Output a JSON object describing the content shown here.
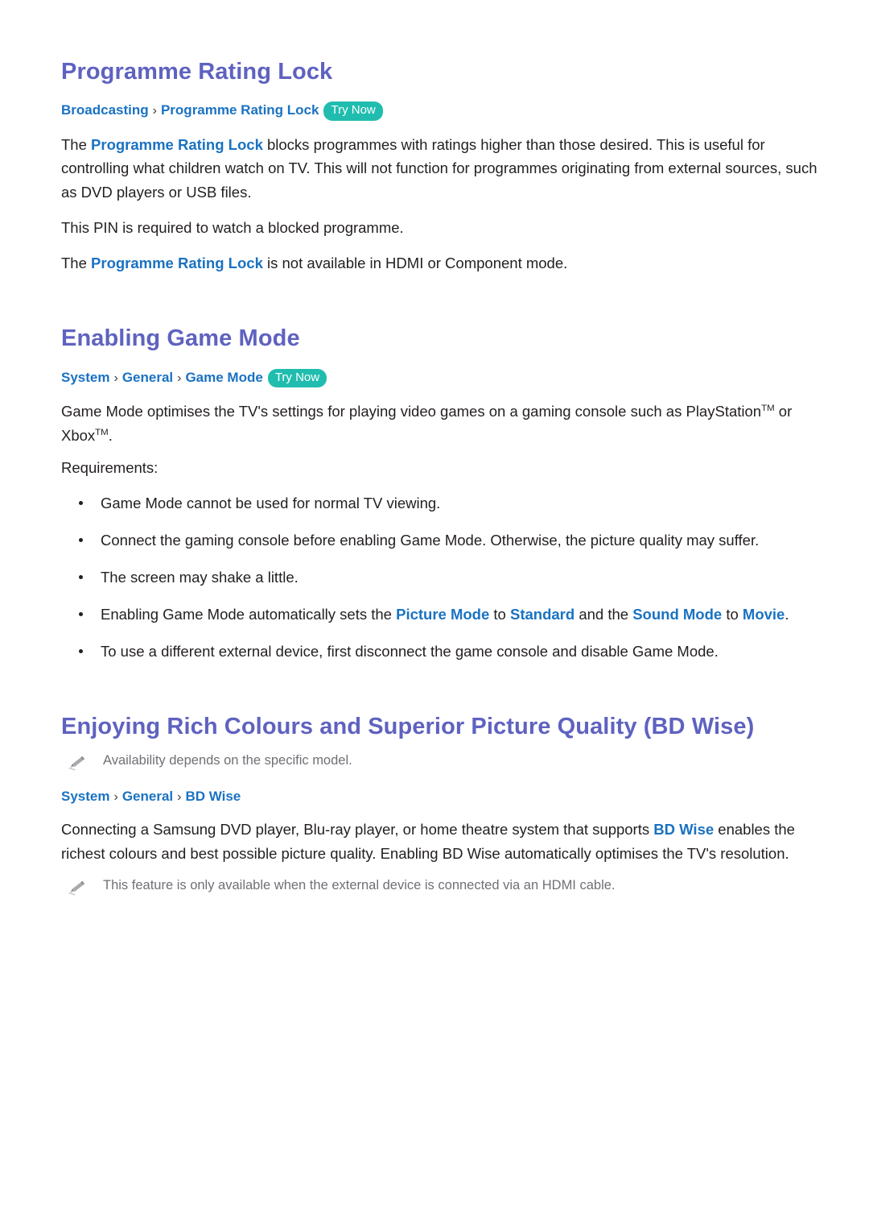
{
  "document": {
    "background_color": "#ffffff",
    "heading_color": "#5f62c0",
    "link_color": "#1a72c2",
    "badge_color": "#20bdaf",
    "note_color": "#6f7076",
    "body_color": "#231f20"
  },
  "sections": [
    {
      "id": "programme-rating-lock",
      "title": "Programme Rating Lock",
      "breadcrumb": {
        "crumbs": [
          "Broadcasting",
          "Programme Rating Lock"
        ],
        "separator": "›",
        "badge": "Try Now"
      },
      "paragraphs": [
        {
          "id": "para-1",
          "text_before": "The ",
          "keyword": "Programme Rating Lock",
          "text_after": " blocks programmes with ratings higher than those desired. This is useful for controlling what children watch on TV. This will not function for programmes originating from external sources, such as DVD players or USB files."
        },
        {
          "id": "para-2",
          "text": "This PIN is required to watch a blocked programme."
        },
        {
          "id": "para-3",
          "text_before": "The ",
          "keyword": "Programme Rating Lock",
          "text_after": " is not available in HDMI or Component mode."
        }
      ]
    },
    {
      "id": "enabling-game-mode",
      "title": "Enabling Game Mode",
      "breadcrumb": {
        "crumbs": [
          "System",
          "General",
          "Game Mode"
        ],
        "separator": "›",
        "badge": "Try Now"
      },
      "intro_before": "Game Mode optimises the TV's settings for playing video games on a gaming console such as PlayStation",
      "intro_tm_1": "TM",
      "intro_mid": " or Xbox",
      "intro_tm_2": "TM",
      "intro_after": ".",
      "requirements_label": "Requirements:",
      "requirements": [
        {
          "id": "req-1",
          "text": "Game Mode cannot be used for normal TV viewing."
        },
        {
          "id": "req-2",
          "text": "Connect the gaming console before enabling Game Mode. Otherwise, the picture quality may suffer."
        },
        {
          "id": "req-3",
          "text": "The screen may shake a little."
        },
        {
          "id": "req-4",
          "rich": {
            "t0": "Enabling Game Mode automatically sets the ",
            "k1": "Picture Mode",
            "t1": " to ",
            "k2": "Standard",
            "t2": " and the ",
            "k3": "Sound Mode",
            "t3": " to ",
            "k4": "Movie",
            "t4": "."
          }
        },
        {
          "id": "req-5",
          "text": "To use a different external device, first disconnect the game console and disable Game Mode."
        }
      ]
    },
    {
      "id": "bd-wise",
      "title": "Enjoying Rich Colours and Superior Picture Quality (BD Wise)",
      "note_top": "Availability depends on the specific model.",
      "breadcrumb": {
        "crumbs": [
          "System",
          "General",
          "BD Wise"
        ],
        "separator": "›",
        "badge": null
      },
      "paragraph": {
        "text_before": "Connecting a Samsung DVD player, Blu-ray player, or home theatre system that supports ",
        "keyword": "BD Wise",
        "text_after": " enables the richest colours and best possible picture quality. Enabling BD Wise automatically optimises the TV's resolution."
      },
      "note_bottom": "This feature is only available when the external device is connected via an HDMI cable."
    }
  ]
}
